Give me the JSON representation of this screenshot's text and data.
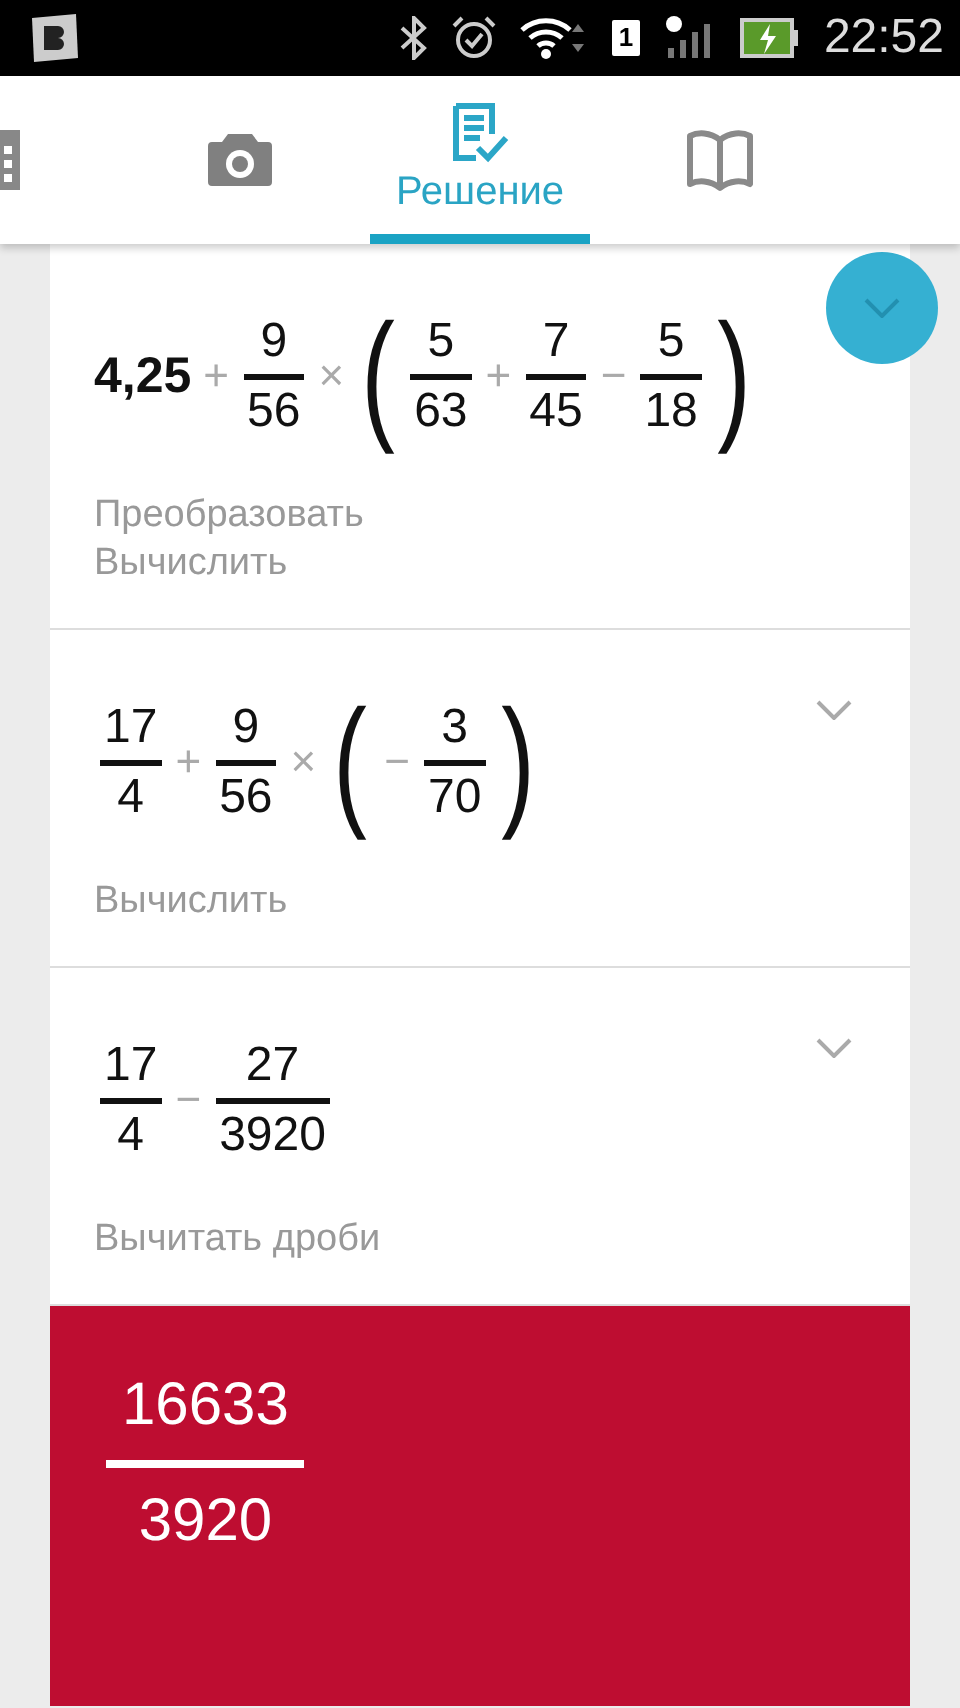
{
  "status_bar": {
    "sim": "1",
    "time": "22:52"
  },
  "tabs": [
    {
      "selected": false
    },
    {
      "selected": false
    },
    {
      "label": "Решение",
      "selected": true
    },
    {
      "selected": false
    }
  ],
  "steps": [
    {
      "expression": [
        {
          "kind": "number",
          "text": "4,25"
        },
        {
          "kind": "op",
          "text": "+"
        },
        {
          "kind": "frac",
          "num": "9",
          "den": "56"
        },
        {
          "kind": "op",
          "text": "×"
        },
        {
          "kind": "paren",
          "text": "("
        },
        {
          "kind": "frac",
          "num": "5",
          "den": "63"
        },
        {
          "kind": "op",
          "text": "+"
        },
        {
          "kind": "frac",
          "num": "7",
          "den": "45"
        },
        {
          "kind": "op",
          "text": "−"
        },
        {
          "kind": "frac",
          "num": "5",
          "den": "18"
        },
        {
          "kind": "paren",
          "text": ")"
        }
      ],
      "actions": [
        "Преобразовать",
        "Вычислить"
      ],
      "highlighted": true
    },
    {
      "expression": [
        {
          "kind": "frac",
          "num": "17",
          "den": "4"
        },
        {
          "kind": "op",
          "text": "+"
        },
        {
          "kind": "frac",
          "num": "9",
          "den": "56"
        },
        {
          "kind": "op",
          "text": "×"
        },
        {
          "kind": "paren",
          "text": "("
        },
        {
          "kind": "op",
          "text": "−"
        },
        {
          "kind": "frac",
          "num": "3",
          "den": "70"
        },
        {
          "kind": "paren",
          "text": ")"
        }
      ],
      "actions": [
        "Вычислить"
      ],
      "highlighted": false
    },
    {
      "expression": [
        {
          "kind": "frac",
          "num": "17",
          "den": "4"
        },
        {
          "kind": "op",
          "text": "−"
        },
        {
          "kind": "frac",
          "num": "27",
          "den": "3920"
        }
      ],
      "actions": [
        "Вычитать дроби"
      ],
      "highlighted": false
    }
  ],
  "result": {
    "num": "16633",
    "den": "3920"
  }
}
